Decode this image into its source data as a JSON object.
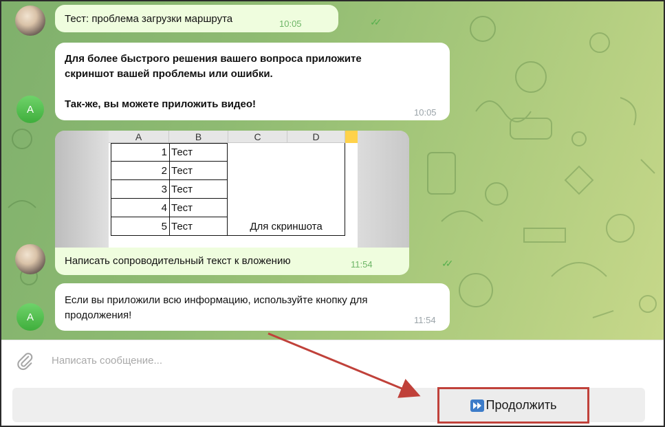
{
  "messages": [
    {
      "id": "m1",
      "direction": "outgoing",
      "text": "Тест: проблема загрузки маршрута",
      "time": "10:05"
    },
    {
      "id": "m2",
      "direction": "incoming",
      "lines": [
        "Для более быстрого решения вашего вопроса приложите",
        "скриншот вашей проблемы или ошибки.",
        "",
        "Так-же, вы можете приложить видео!"
      ],
      "time": "10:05"
    },
    {
      "id": "m3",
      "direction": "outgoing",
      "caption": "Написать сопроводительный текст к вложению",
      "time": "11:54"
    },
    {
      "id": "m4",
      "direction": "incoming",
      "lines": [
        "Если вы приложили всю информацию, используйте кнопку для",
        "продолжения!"
      ],
      "time": "11:54"
    }
  ],
  "avatar_letter": "A",
  "sheet": {
    "columns": [
      "A",
      "B",
      "C",
      "D"
    ],
    "rows": [
      {
        "num": "1",
        "b": "Тест"
      },
      {
        "num": "2",
        "b": "Тест"
      },
      {
        "num": "3",
        "b": "Тест"
      },
      {
        "num": "4",
        "b": "Тест"
      },
      {
        "num": "5",
        "b": "Тест"
      }
    ],
    "merged_text": "Для скриншота"
  },
  "input": {
    "placeholder": "Написать сообщение..."
  },
  "keyboard": {
    "button_label": "Продолжить",
    "button_icon": "fast-forward-icon"
  },
  "colors": {
    "accent_red": "#c0413a",
    "outgoing_bubble": "#effdde",
    "read_check": "#58b04e",
    "avatar_green": "#4cbc48"
  }
}
